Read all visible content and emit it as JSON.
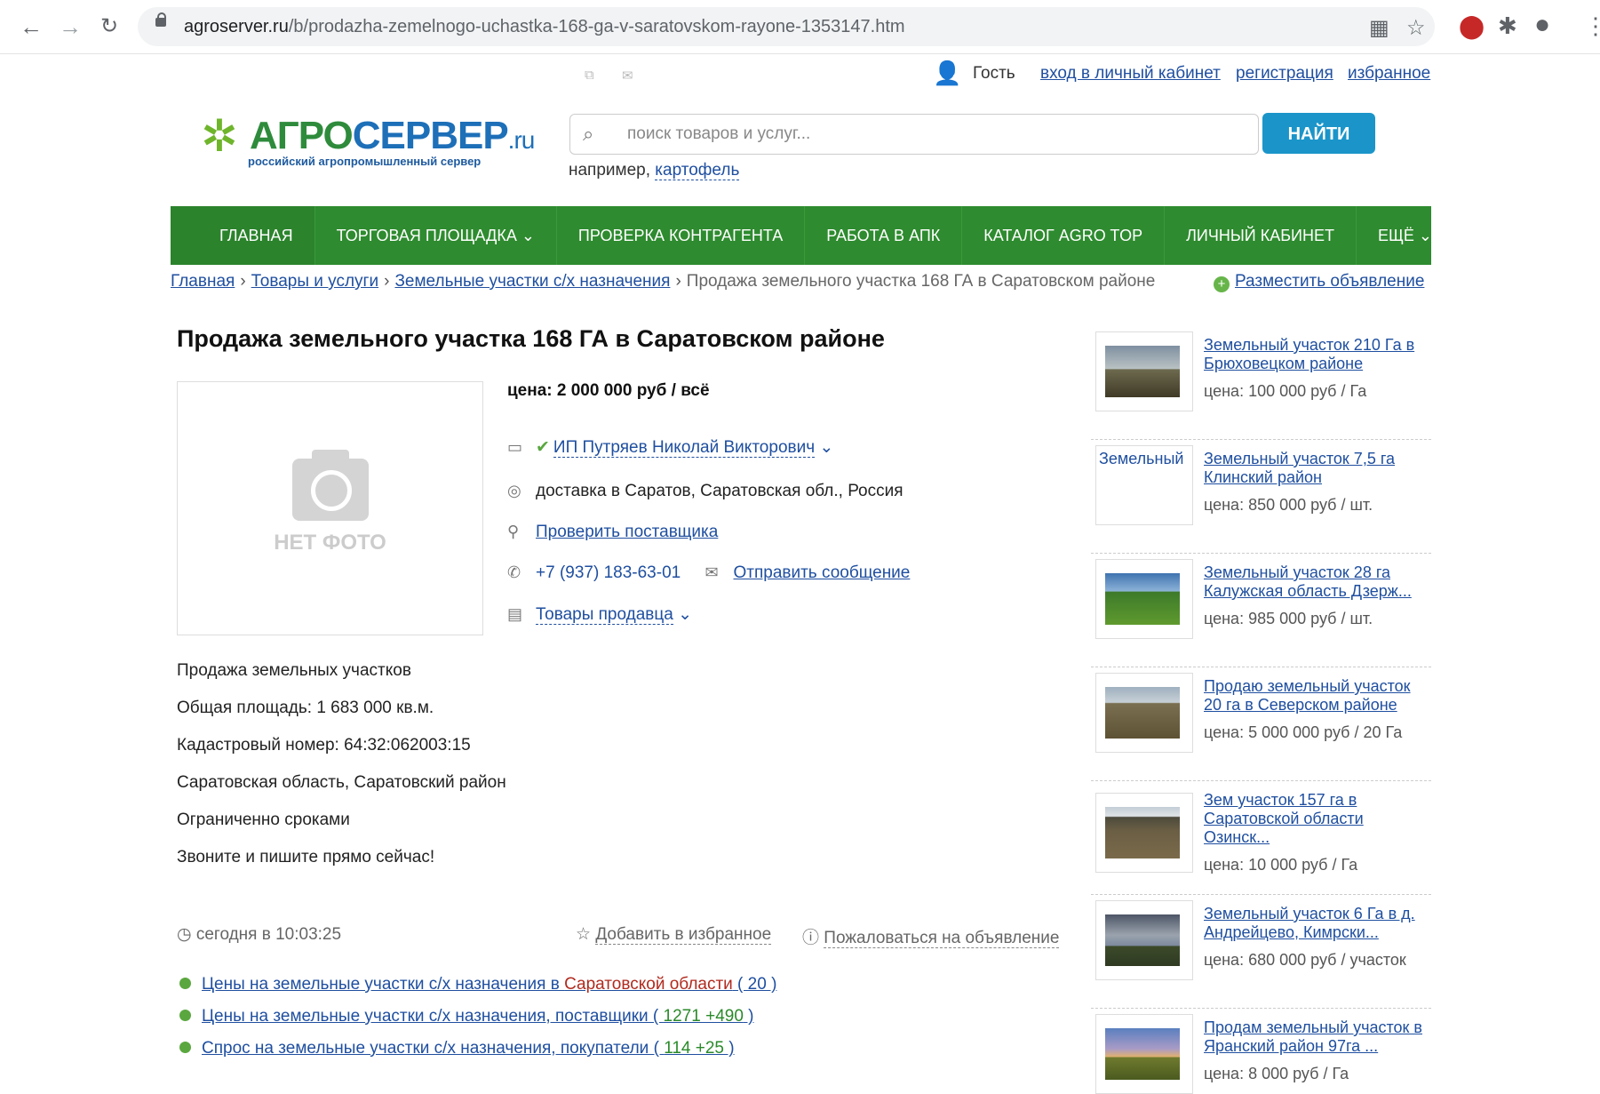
{
  "browser": {
    "url_host": "agroserver.ru",
    "url_path": "/b/prodazha-zemelnogo-uchastka-168-ga-v-saratovskom-rayone-1353147.htm"
  },
  "util": {
    "guest": "Гость",
    "login": "вход в личный кабинет",
    "register": "регистрация",
    "favorites": "избранное"
  },
  "logo": {
    "name_green": "АГРО",
    "name_blue": "СЕРВЕР",
    "suffix": ".ru",
    "tagline": "российский агропромышленный сервер"
  },
  "search": {
    "placeholder": "поиск товаров и услуг...",
    "button": "НАЙТИ",
    "hint_prefix": "например,",
    "hint_link": "картофель"
  },
  "nav": [
    "ГЛАВНАЯ",
    "ТОРГОВАЯ ПЛОЩАДКА ⌄",
    "ПРОВЕРКА КОНТРАГЕНТА",
    "РАБОТА В АПК",
    "КАТАЛОГ AGRO TOP",
    "ЛИЧНЫЙ КАБИНЕТ",
    "ЕЩЁ ⌄"
  ],
  "breadcrumb": {
    "items": [
      "Главная",
      "Товары и услуги",
      "Земельные участки с/х назначения"
    ],
    "current": "Продажа земельного участка 168 ГА в Саратовском районе",
    "post_ad": "Разместить объявление"
  },
  "listing": {
    "title": "Продажа земельного участка 168 ГА в Саратовском районе",
    "no_photo": "НЕТ ФОТО",
    "price": "цена: 2 000 000 руб / всё",
    "seller": "ИП Путряев Николай Викторович",
    "delivery": "доставка в Саратов, Саратовская обл., Россия",
    "check_supplier": "Проверить поставщика",
    "phone": "+7 (937) 183-63-01",
    "send_message": "Отправить сообщение",
    "seller_goods": "Товары продавца",
    "description": [
      "Продажа земельных участков",
      "Общая площадь: 1 683 000 кв.м.",
      "Кадастровый номер: 64:32:062003:15",
      "Саратовская область, Саратовский район",
      "Ограниченно сроками",
      "Звоните и пишите прямо сейчас!"
    ],
    "posted": "сегодня в 10:03:25",
    "add_favorite": "Добавить в избранное",
    "report": "Пожаловаться на объявление"
  },
  "related_links": [
    {
      "a": "Цены на земельные участки с/х назначения в ",
      "b": "Саратовской области",
      "c": " ( 20 )"
    },
    {
      "a": "Цены на земельные участки с/х назначения, поставщики ( ",
      "b": "1271 +490",
      "c": " )"
    },
    {
      "a": "Спрос на земельные участки с/х назначения, покупатели ( ",
      "b": "114 +25",
      "c": " )"
    }
  ],
  "sidebar": [
    {
      "title": "Земельный участок 210 Га в Брюховецком районе",
      "price": "цена: 100 000 руб / Га",
      "img": "field-dusk"
    },
    {
      "title": "Земельный участок 7,5 га Клинский район",
      "price": "цена: 850 000 руб / шт.",
      "img": "broken",
      "alt": "Земельный"
    },
    {
      "title": "Земельный участок 28 га Калужская область Дзерж...",
      "price": "цена: 985 000 руб / шт.",
      "img": "field-green"
    },
    {
      "title": "Продаю земельный участок 20 га в Северском районе",
      "price": "цена: 5 000 000 руб / 20 Га",
      "img": "field-brown"
    },
    {
      "title": "Зем участок 157 га в Саратовской области Озинск...",
      "price": "цена: 10 000 руб / Га",
      "img": "field-trees"
    },
    {
      "title": "Земельный участок 6 Га в д. Андрейцево, Кимрски...",
      "price": "цена: 680 000 руб / участок",
      "img": "field-cloudy"
    },
    {
      "title": "Продам земельный участок в Яранский район 97га ...",
      "price": "цена: 8 000 руб / Га",
      "img": "field-sunset"
    }
  ]
}
